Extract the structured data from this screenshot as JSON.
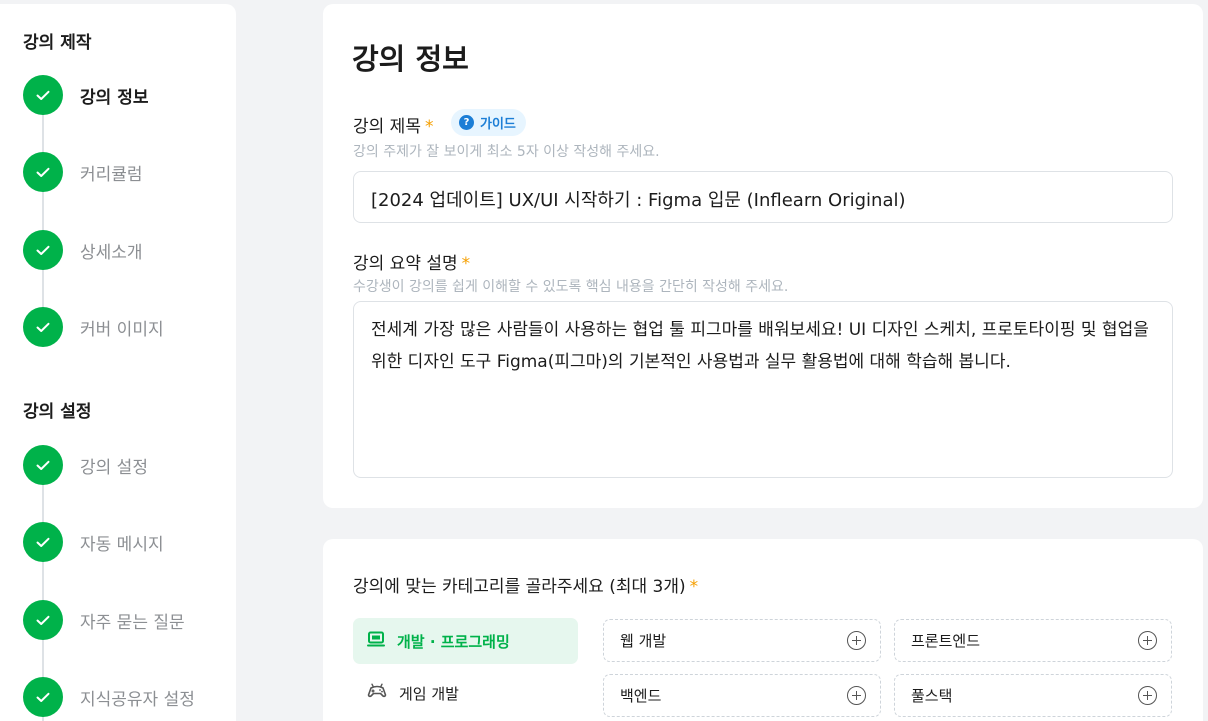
{
  "sidebar": {
    "section1_title": "강의 제작",
    "section1_steps": [
      {
        "label": "강의 정보",
        "active": true
      },
      {
        "label": "커리큘럼"
      },
      {
        "label": "상세소개"
      },
      {
        "label": "커버 이미지"
      }
    ],
    "section2_title": "강의 설정",
    "section2_steps": [
      {
        "label": "강의 설정"
      },
      {
        "label": "자동 메시지"
      },
      {
        "label": "자주 묻는 질문"
      },
      {
        "label": "지식공유자 설정"
      }
    ]
  },
  "main": {
    "page_title": "강의 정보",
    "title_field": {
      "label": "강의 제목",
      "required_mark": "*",
      "guide_icon": "?",
      "guide_label": "가이드",
      "hint": "강의 주제가 잘 보이게 최소 5자 이상 작성해 주세요.",
      "value": "[2024 업데이트] UX/UI 시작하기 : Figma 입문 (Inflearn Original)"
    },
    "summary_field": {
      "label": "강의 요약 설명",
      "required_mark": "*",
      "hint": "수강생이 강의를 쉽게 이해할 수 있도록 핵심 내용을 간단히 작성해 주세요.",
      "value": "전세계 가장 많은 사람들이 사용하는 협업 툴 피그마를 배워보세요! UI 디자인 스케치, 프로토타이핑 및 협업을 위한 디자인 도구 Figma(피그마)의 기본적인 사용법과 실무 활용법에 대해 학습해 봅니다."
    }
  },
  "category": {
    "label": "강의에 맞는 카테고리를 골라주세요 (최대 3개)",
    "required_mark": "*",
    "main_categories": [
      {
        "label": "개발 · 프로그래밍",
        "icon": "monitor-icon",
        "selected": true
      },
      {
        "label": "게임 개발",
        "icon": "game-controller-icon"
      }
    ],
    "sub_categories": [
      "웹 개발",
      "프론트엔드",
      "백엔드",
      "풀스택"
    ]
  },
  "colors": {
    "accent_green": "#00b24a",
    "required_orange": "#f59f00",
    "guide_blue": "#1c7ed6"
  }
}
